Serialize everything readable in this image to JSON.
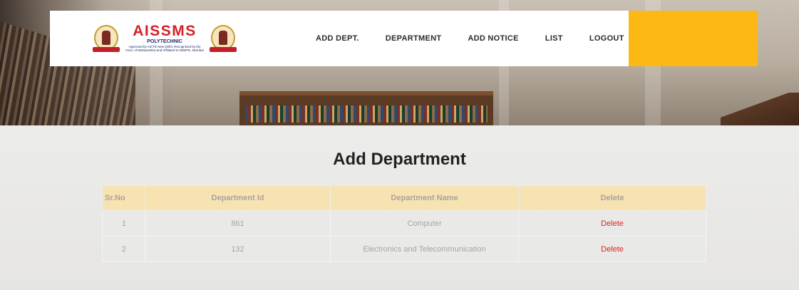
{
  "brand": {
    "name": "AISSMS",
    "subtitle": "POLYTECHNIC",
    "tagline_1": "Approved by AICTE New Delhi, Recognized by the",
    "tagline_2": "Govt. of Maharashtra and Affiliated to MSBTE, Mumbai"
  },
  "nav": {
    "items": [
      {
        "label": "ADD DEPT."
      },
      {
        "label": "DEPARTMENT"
      },
      {
        "label": "ADD NOTICE"
      },
      {
        "label": "LIST"
      },
      {
        "label": "LOGOUT"
      }
    ],
    "accent_color": "#fdb813"
  },
  "page": {
    "title": "Add Department"
  },
  "table": {
    "headers": [
      "Sr.No",
      "Department Id",
      "Department Name",
      "Delete"
    ],
    "rows": [
      {
        "sr": "1",
        "id": "861",
        "name": "Computer",
        "action": "Delete"
      },
      {
        "sr": "2",
        "id": "132",
        "name": "Electronics and Telecommunication",
        "action": "Delete"
      }
    ],
    "header_color": "#f7e2b2",
    "delete_color": "#e0261d"
  }
}
